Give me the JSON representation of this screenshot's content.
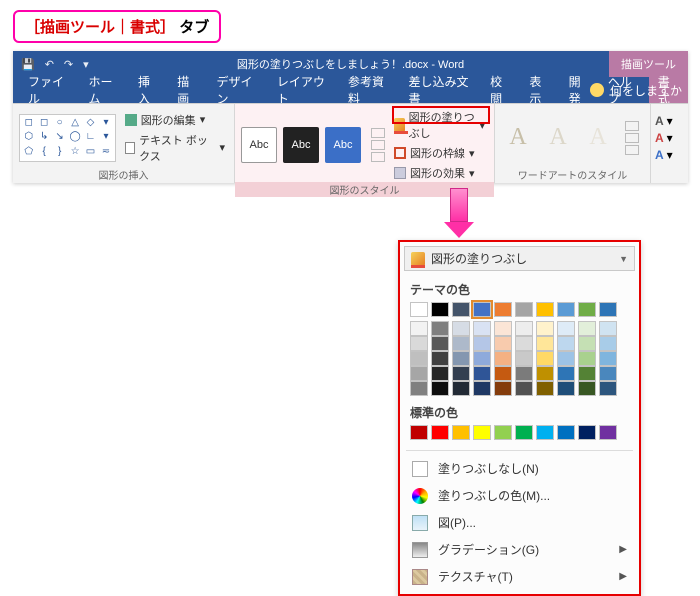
{
  "callout": {
    "red_part": "［描画ツール｜書式］",
    "black_part": "タブ"
  },
  "titlebar": {
    "doc_title": "図形の塗りつぶしをしましょう！.docx - Word",
    "contextual_label": "描画ツール"
  },
  "tabs": {
    "items": [
      "ファイル",
      "ホーム",
      "挿入",
      "描画",
      "デザイン",
      "レイアウト",
      "参考資料",
      "差し込み文書",
      "校閲",
      "表示",
      "開発",
      "ヘルプ",
      "書式"
    ],
    "active": "書式",
    "tell_me": "何をしますか"
  },
  "ribbon": {
    "group1": {
      "label": "図形の挿入",
      "edit_shape": "図形の編集",
      "textbox": "テキスト ボックス"
    },
    "group2": {
      "label": "図形のスタイル",
      "abc": "Abc",
      "fill": "図形の塗りつぶし",
      "outline": "図形の枠線",
      "effects": "図形の効果"
    },
    "group3": {
      "label": "ワードアートのスタイル",
      "glyph": "A"
    },
    "group4": {
      "a1": "A",
      "a2": "A",
      "a3": "A"
    }
  },
  "dropdown": {
    "header": "図形の塗りつぶし",
    "theme_title": "テーマの色",
    "theme_row1": [
      "#ffffff",
      "#000000",
      "#44546a",
      "#4472c4",
      "#ed7d31",
      "#a5a5a5",
      "#ffc000",
      "#5b9bd5",
      "#70ad47",
      "#2e75b6"
    ],
    "theme_shades": [
      [
        "#f2f2f2",
        "#7f7f7f",
        "#d6dce5",
        "#d9e2f3",
        "#fbe5d6",
        "#ededed",
        "#fff2cc",
        "#deebf7",
        "#e2efda",
        "#d0e3f1"
      ],
      [
        "#d9d9d9",
        "#595959",
        "#adb9ca",
        "#b4c6e7",
        "#f8cbad",
        "#dbdbdb",
        "#ffe699",
        "#bdd7ee",
        "#c5e0b4",
        "#a8cce8"
      ],
      [
        "#bfbfbf",
        "#404040",
        "#8497b0",
        "#8eaadb",
        "#f4b183",
        "#c9c9c9",
        "#ffd966",
        "#9dc3e6",
        "#a9d18e",
        "#7fb5de"
      ],
      [
        "#a6a6a6",
        "#262626",
        "#333f50",
        "#2f5597",
        "#c55a11",
        "#7b7b7b",
        "#bf9000",
        "#2e75b6",
        "#548235",
        "#4a87bd"
      ],
      [
        "#808080",
        "#0d0d0d",
        "#222a35",
        "#1f3864",
        "#843c0c",
        "#525252",
        "#806000",
        "#1f4e79",
        "#385723",
        "#2d567e"
      ]
    ],
    "standard_title": "標準の色",
    "standard": [
      "#c00000",
      "#ff0000",
      "#ffc000",
      "#ffff00",
      "#92d050",
      "#00b050",
      "#00b0f0",
      "#0070c0",
      "#002060",
      "#7030a0"
    ],
    "items": {
      "no_fill": "塗りつぶしなし(N)",
      "more_colors": "塗りつぶしの色(M)...",
      "picture": "図(P)...",
      "gradient": "グラデーション(G)",
      "texture": "テクスチャ(T)"
    }
  }
}
